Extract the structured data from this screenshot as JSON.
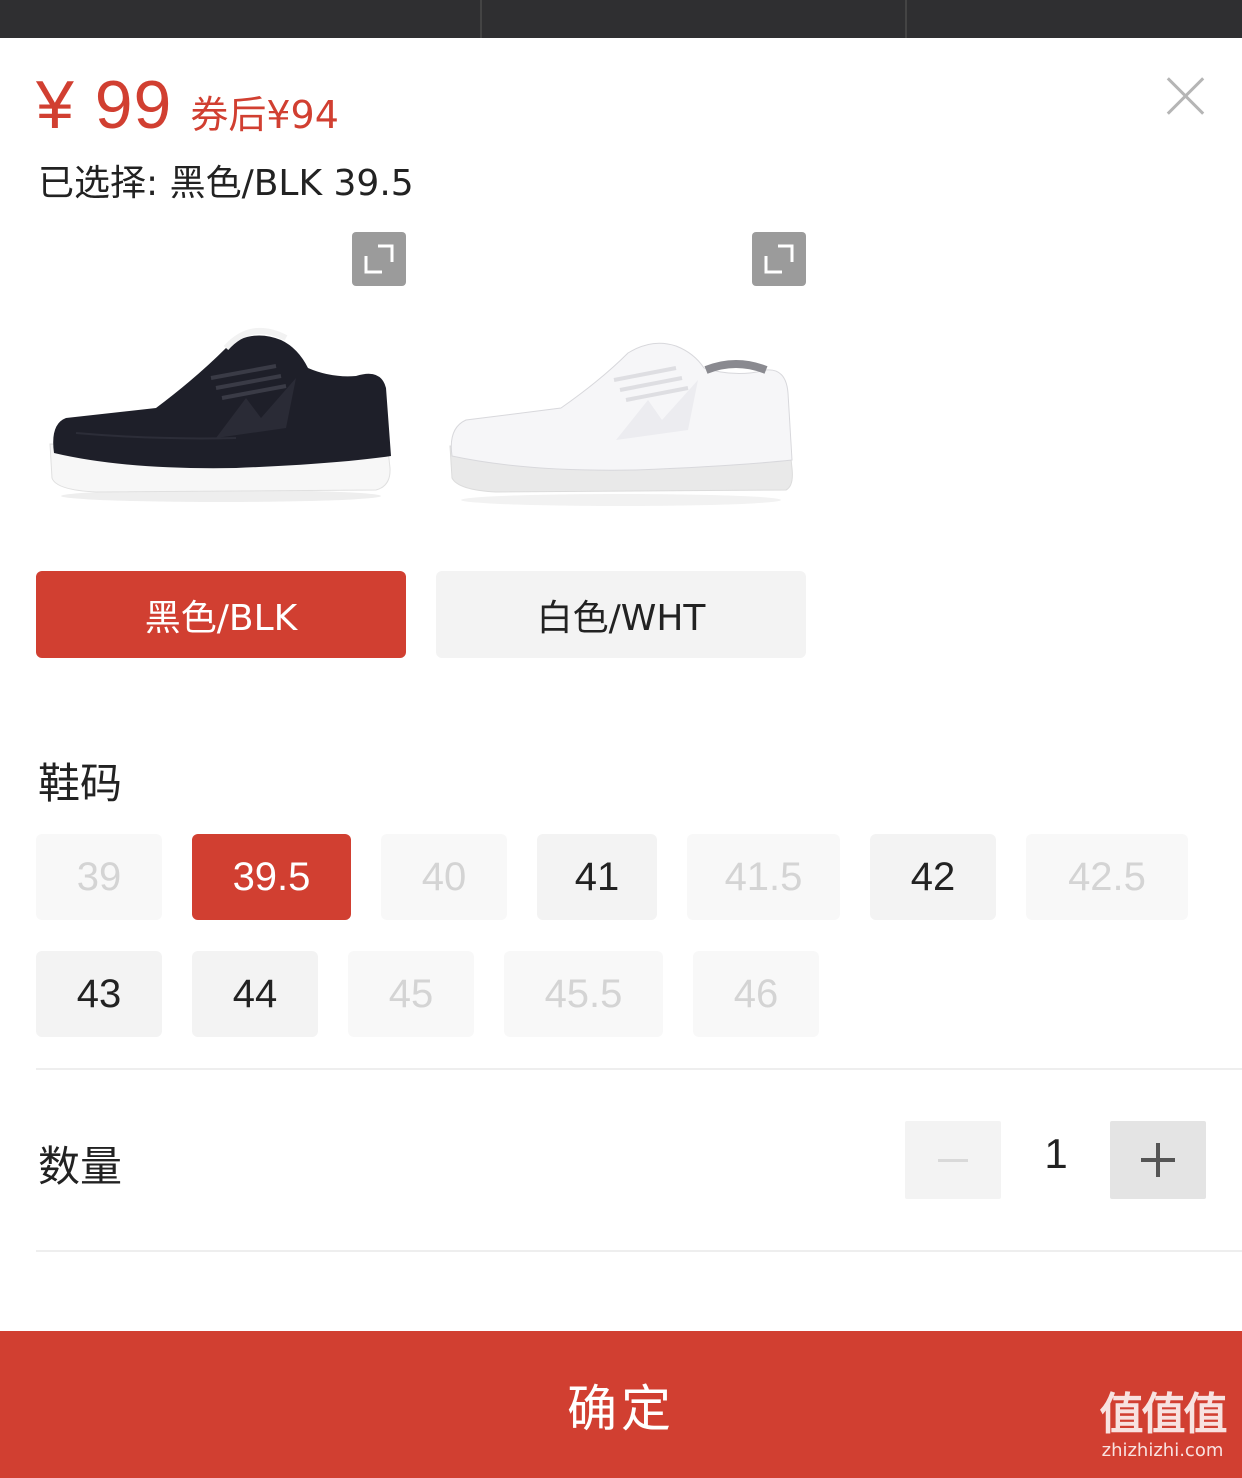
{
  "product": {
    "price": "¥ 99",
    "coupon_price": "券后¥94",
    "selected_text": "已选择: 黑色/BLK 39.5"
  },
  "colors": [
    {
      "label": "黑色/BLK",
      "image": "black sneaker",
      "state": "selected"
    },
    {
      "label": "白色/WHT",
      "image": "white sneaker",
      "state": "unselected"
    }
  ],
  "sizes": {
    "title": "鞋码",
    "options": [
      {
        "label": "39",
        "state": "disabled"
      },
      {
        "label": "39.5",
        "state": "selected"
      },
      {
        "label": "40",
        "state": "disabled"
      },
      {
        "label": "41",
        "state": "available"
      },
      {
        "label": "41.5",
        "state": "disabled"
      },
      {
        "label": "42",
        "state": "available"
      },
      {
        "label": "42.5",
        "state": "disabled"
      },
      {
        "label": "43",
        "state": "available"
      },
      {
        "label": "44",
        "state": "available"
      },
      {
        "label": "45",
        "state": "disabled"
      },
      {
        "label": "45.5",
        "state": "disabled"
      },
      {
        "label": "46",
        "state": "disabled"
      }
    ]
  },
  "quantity": {
    "title": "数量",
    "value": "1"
  },
  "confirm_label": "确定",
  "watermark": {
    "logo": "值值值",
    "url": "zhizhizhi.com"
  },
  "theme": {
    "accent": "#d13f31",
    "chip_bg": "#f3f3f3",
    "disabled_text": "#d4d4d4"
  }
}
